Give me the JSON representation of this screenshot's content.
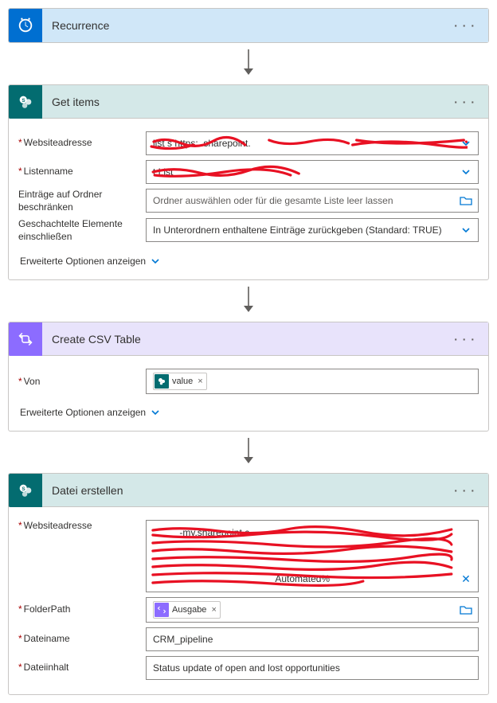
{
  "recurrence": {
    "title": "Recurrence"
  },
  "getItems": {
    "title": "Get items",
    "fields": {
      "siteAddress": {
        "label": "Websiteadresse",
        "value": "list s          https:      .sharepoint."
      },
      "listName": {
        "label": "Listenname",
        "value": "                           t List"
      },
      "limitFolder": {
        "label": "Einträge auf Ordner beschränken",
        "placeholder": "Ordner auswählen oder für die gesamte Liste leer lassen"
      },
      "nested": {
        "label": "Geschachtelte Elemente einschließen",
        "value": "In Unterordnern enthaltene Einträge zurückgeben (Standard: TRUE)"
      }
    },
    "advanced": "Erweiterte Optionen anzeigen"
  },
  "createCsv": {
    "title": "Create CSV Table",
    "fields": {
      "from": {
        "label": "Von",
        "tokenLabel": "value"
      }
    },
    "advanced": "Erweiterte Optionen anzeigen"
  },
  "createFile": {
    "title": "Datei erstellen",
    "fields": {
      "siteAddress": {
        "label": "Websiteadresse",
        "visibleFrag1": "-my.sharepoint.c",
        "visibleFrag2": "Automated%"
      },
      "folderPath": {
        "label": "FolderPath",
        "tokenLabel": "Ausgabe"
      },
      "fileName": {
        "label": "Dateiname",
        "value": "CRM_pipeline"
      },
      "fileContent": {
        "label": "Dateiinhalt",
        "value": "Status update of open and lost opportunities"
      }
    }
  }
}
